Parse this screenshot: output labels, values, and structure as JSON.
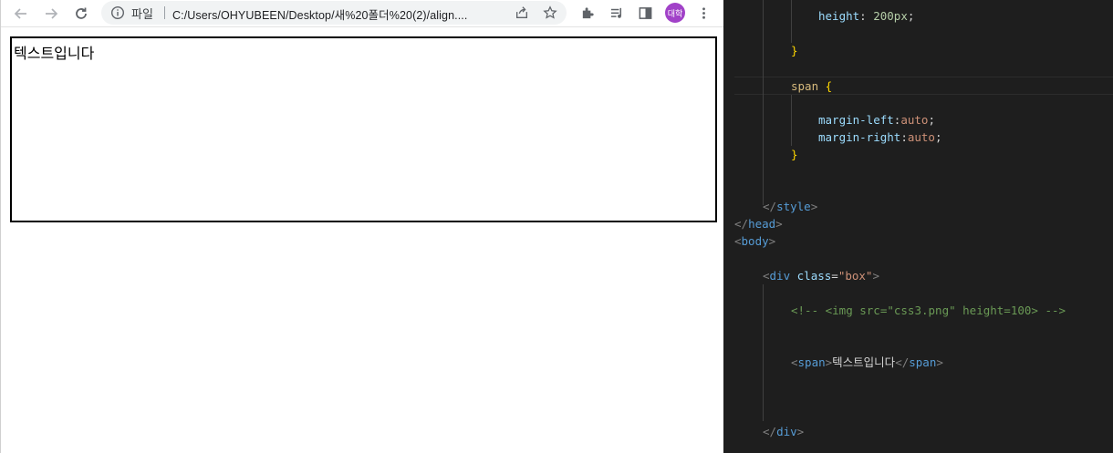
{
  "browser": {
    "nav": {
      "back_icon": "arrow-left-icon",
      "forward_icon": "arrow-right-icon",
      "reload_icon": "reload-icon"
    },
    "omnibox": {
      "info_icon": "info-icon",
      "scheme_label": "파일",
      "url": "C:/Users/OHYUBEEN/Desktop/새%20폴더%20(2)/align...."
    },
    "toolbar_icons": [
      "share-icon",
      "star-icon",
      "extensions-icon",
      "media-icon",
      "side-panel-icon",
      "menu-icon"
    ],
    "profile": {
      "avatar_text": "대학",
      "color": "#a142c8"
    },
    "page": {
      "box_text": "텍스트입니다"
    }
  },
  "editor": {
    "lines": {
      "height_prop": "height",
      "height_val": "200px",
      "close_brace_1": "}",
      "span_sel": "span",
      "open_brace": "{",
      "ml_prop": "margin-left",
      "ml_val": "auto",
      "mr_prop": "margin-right",
      "mr_val": "auto",
      "close_brace_2": "}",
      "style_close_tag": "style",
      "head_close_tag": "head",
      "body_open_tag": "body",
      "div_tag": "div",
      "div_attr": "class",
      "div_attr_val": "\"box\"",
      "comment": "<!-- <img src=\"css3.png\" height=100> -->",
      "span_tag": "span",
      "span_text": "텍스트입니다",
      "div_close_tag": "div"
    }
  }
}
